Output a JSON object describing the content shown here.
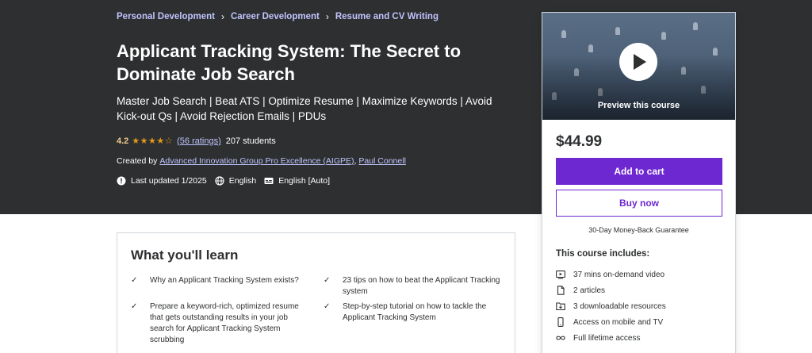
{
  "breadcrumb": [
    {
      "label": "Personal Development"
    },
    {
      "label": "Career Development"
    },
    {
      "label": "Resume and CV Writing"
    }
  ],
  "course": {
    "title": "Applicant Tracking System: The Secret to Dominate Job Search",
    "subtitle": "Master Job Search | Beat ATS | Optimize Resume | Maximize Keywords | Avoid Kick-out Qs | Avoid Rejection Emails | PDUs",
    "rating": "4.2",
    "stars_value": 4.2,
    "stars_glyphs": "★★★★☆",
    "ratings_count": "(56 ratings)",
    "students": "207 students",
    "created_by_label": "Created by",
    "instructors": [
      "Advanced Innovation Group Pro Excellence (AIGPE)",
      "Paul Connell"
    ],
    "last_updated": "Last updated 1/2025",
    "language": "English",
    "captions": "English [Auto]"
  },
  "sidebar": {
    "preview_label": "Preview this course",
    "price": "$44.99",
    "add_to_cart": "Add to cart",
    "buy_now": "Buy now",
    "guarantee": "30-Day Money-Back Guarantee",
    "includes_title": "This course includes:",
    "includes": [
      {
        "icon": "video-icon",
        "label": "37 mins on-demand video"
      },
      {
        "icon": "file-icon",
        "label": "2 articles"
      },
      {
        "icon": "download-folder-icon",
        "label": "3 downloadable resources"
      },
      {
        "icon": "mobile-icon",
        "label": "Access on mobile and TV"
      },
      {
        "icon": "infinity-icon",
        "label": "Full lifetime access"
      }
    ]
  },
  "learn": {
    "title": "What you'll learn",
    "items": [
      "Why an Applicant Tracking System exists?",
      "23 tips on how to beat the Applicant Tracking system",
      "Prepare a keyword-rich, optimized resume that gets outstanding results in your job search for Applicant Tracking System scrubbing",
      "Step-by-step tutorial on how to tackle the Applicant Tracking System"
    ]
  },
  "colors": {
    "hero_bg": "#2d2f31",
    "link_lavender": "#c0c4fc",
    "rating_gold": "#f3ca8c",
    "star_orange": "#e59819",
    "brand_purple": "#6d28d2"
  }
}
